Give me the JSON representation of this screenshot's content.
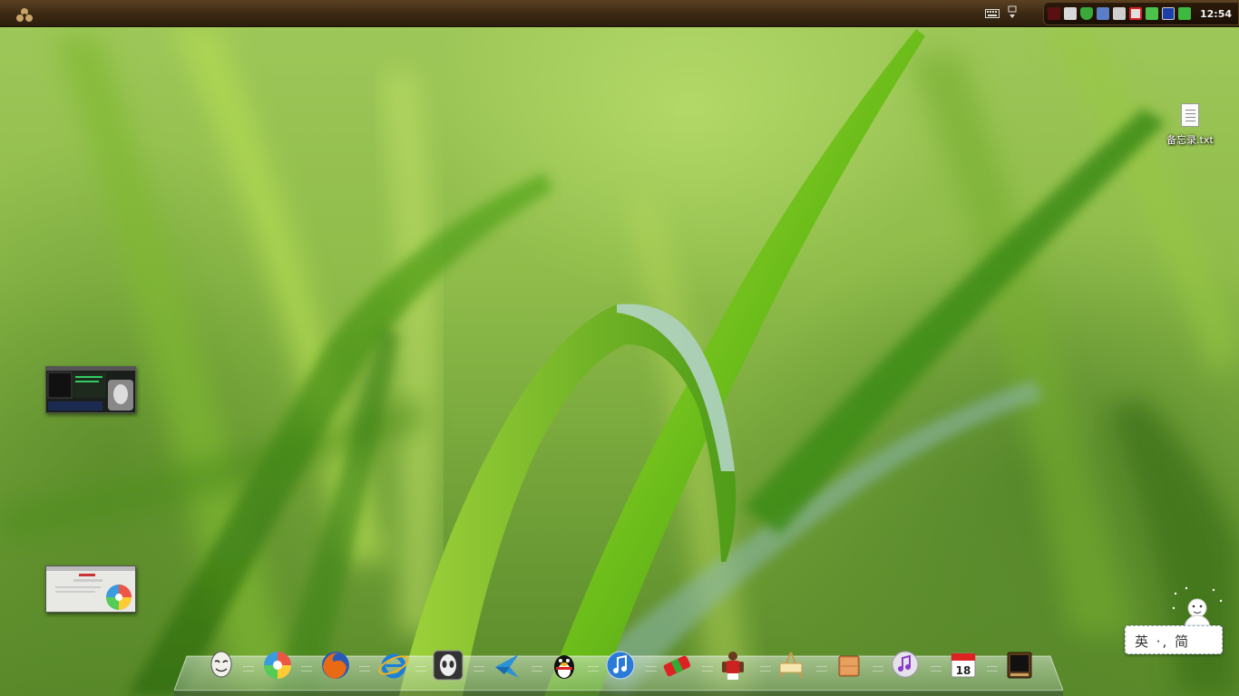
{
  "topbar": {
    "clock": "12:54",
    "tray_icons": [
      "red-spider-icon",
      "monitor-icon",
      "shield-icon",
      "network-icon",
      "bluetooth-icon",
      "volume-muted-icon",
      "security-icon",
      "display-icon",
      "battery-icon"
    ]
  },
  "desktop": {
    "icons": [
      {
        "label": "备忘录.txt",
        "icon": "text-file-icon"
      }
    ]
  },
  "dock": {
    "items": [
      "anonymous-mask-icon",
      "color-pinwheel-icon",
      "firefox-icon",
      "internet-explorer-icon",
      "alienware-icon",
      "bird-icon",
      "qq-penguin-icon",
      "itunes-icon",
      "toolbox-icon",
      "basketball-player-icon",
      "easel-icon",
      "drawer-icon",
      "music-note-icon",
      "calendar-icon",
      "monitor-box-icon"
    ],
    "calendar_day": "18"
  },
  "ime": {
    "text": "英 ·, 简"
  },
  "colors": {
    "topbar": "#3d2a14",
    "wallpaper": "#8fbc4a",
    "clock_text": "#f2f2f2"
  }
}
